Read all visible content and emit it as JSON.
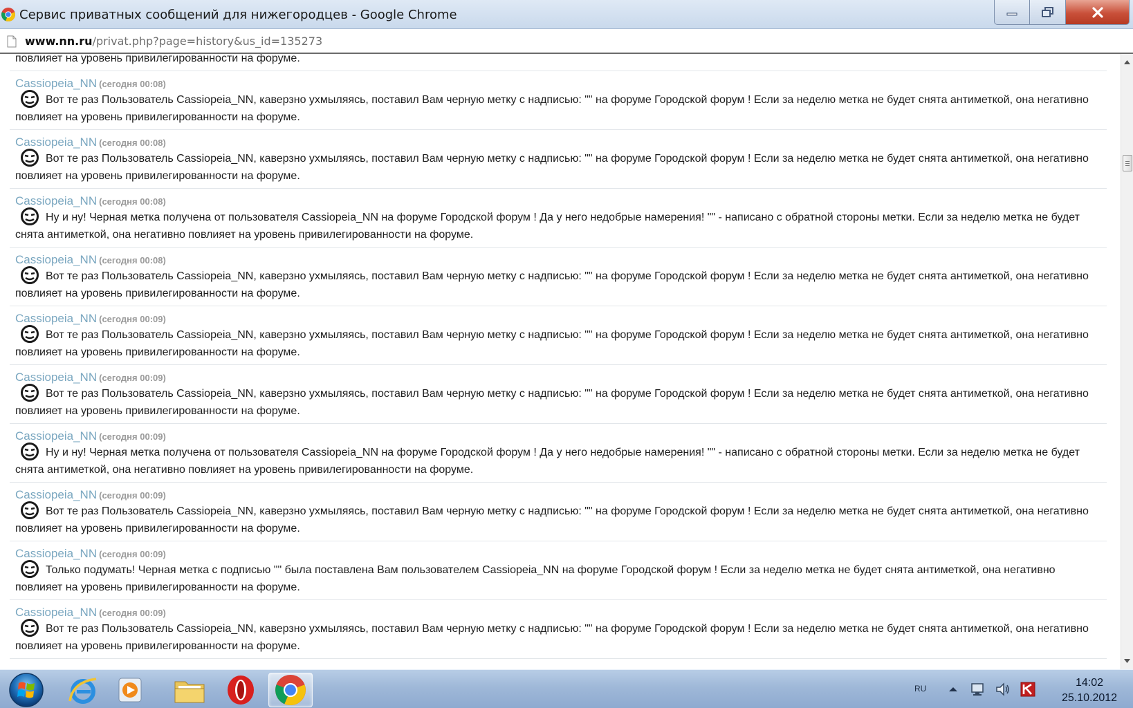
{
  "window": {
    "title": "Сервис приватных сообщений для нижегородцев - Google Chrome"
  },
  "address": {
    "host": "www.nn.ru",
    "path": "/privat.php?page=history&us_id=135273"
  },
  "messages": [
    {
      "author": "",
      "time": "",
      "text": "Вот те раз Пользователь Cassiopeia_NN, каверзно ухмыляясь, поставил Вам черную метку с надписью: \"\" на форуме Городской форум ! Если за неделю метка не будет снята антиметкой, она негативно повлияет на уровень привилегированности на форуме."
    },
    {
      "author": "Cassiopeia_NN",
      "time": "(сегодня 00:08)",
      "text": "Вот те раз Пользователь Cassiopeia_NN, каверзно ухмыляясь, поставил Вам черную метку с надписью: \"\" на форуме Городской форум ! Если за неделю метка не будет снята антиметкой, она негативно повлияет на уровень привилегированности на форуме."
    },
    {
      "author": "Cassiopeia_NN",
      "time": "(сегодня 00:08)",
      "text": "Вот те раз Пользователь Cassiopeia_NN, каверзно ухмыляясь, поставил Вам черную метку с надписью: \"\" на форуме Городской форум ! Если за неделю метка не будет снята антиметкой, она негативно повлияет на уровень привилегированности на форуме."
    },
    {
      "author": "Cassiopeia_NN",
      "time": "(сегодня 00:08)",
      "text": "Ну и ну! Черная метка получена от пользователя Cassiopeia_NN на форуме Городской форум ! Да у него недобрые намерения! \"\" - написано с обратной стороны метки. Если за неделю метка не будет снята антиметкой, она негативно повлияет на уровень привилегированности на форуме."
    },
    {
      "author": "Cassiopeia_NN",
      "time": "(сегодня 00:08)",
      "text": "Вот те раз Пользователь Cassiopeia_NN, каверзно ухмыляясь, поставил Вам черную метку с надписью: \"\" на форуме Городской форум ! Если за неделю метка не будет снята антиметкой, она негативно повлияет на уровень привилегированности на форуме."
    },
    {
      "author": "Cassiopeia_NN",
      "time": "(сегодня 00:09)",
      "text": "Вот те раз Пользователь Cassiopeia_NN, каверзно ухмыляясь, поставил Вам черную метку с надписью: \"\" на форуме Городской форум ! Если за неделю метка не будет снята антиметкой, она негативно повлияет на уровень привилегированности на форуме."
    },
    {
      "author": "Cassiopeia_NN",
      "time": "(сегодня 00:09)",
      "text": "Вот те раз Пользователь Cassiopeia_NN, каверзно ухмыляясь, поставил Вам черную метку с надписью: \"\" на форуме Городской форум ! Если за неделю метка не будет снята антиметкой, она негативно повлияет на уровень привилегированности на форуме."
    },
    {
      "author": "Cassiopeia_NN",
      "time": "(сегодня 00:09)",
      "text": "Ну и ну! Черная метка получена от пользователя Cassiopeia_NN на форуме Городской форум ! Да у него недобрые намерения! \"\" - написано с обратной стороны метки. Если за неделю метка не будет снята антиметкой, она негативно повлияет на уровень привилегированности на форуме."
    },
    {
      "author": "Cassiopeia_NN",
      "time": "(сегодня 00:09)",
      "text": "Вот те раз Пользователь Cassiopeia_NN, каверзно ухмыляясь, поставил Вам черную метку с надписью: \"\" на форуме Городской форум ! Если за неделю метка не будет снята антиметкой, она негативно повлияет на уровень привилегированности на форуме."
    },
    {
      "author": "Cassiopeia_NN",
      "time": "(сегодня 00:09)",
      "text": "Только подумать! Черная метка с подписью \"\" была поставлена Вам пользователем Cassiopeia_NN на форуме Городской форум ! Если за неделю метка не будет снята антиметкой, она негативно повлияет на уровень привилегированности на форуме."
    },
    {
      "author": "Cassiopeia_NN",
      "time": "(сегодня 00:09)",
      "text": "Вот те раз Пользователь Cassiopeia_NN, каверзно ухмыляясь, поставил Вам черную метку с надписью: \"\" на форуме Городской форум ! Если за неделю метка не будет снята антиметкой, она негативно повлияет на уровень привилегированности на форуме."
    }
  ],
  "taskbar": {
    "apps": [
      "internet-explorer-icon",
      "media-player-icon",
      "file-explorer-icon",
      "opera-icon",
      "chrome-icon"
    ],
    "active_app": "chrome-icon"
  },
  "tray": {
    "language": "RU",
    "time": "14:02",
    "date": "25.10.2012"
  },
  "colors": {
    "author_link": "#7aa7c0",
    "close_button": "#c9503a",
    "taskbar": "#9fb8d8"
  }
}
